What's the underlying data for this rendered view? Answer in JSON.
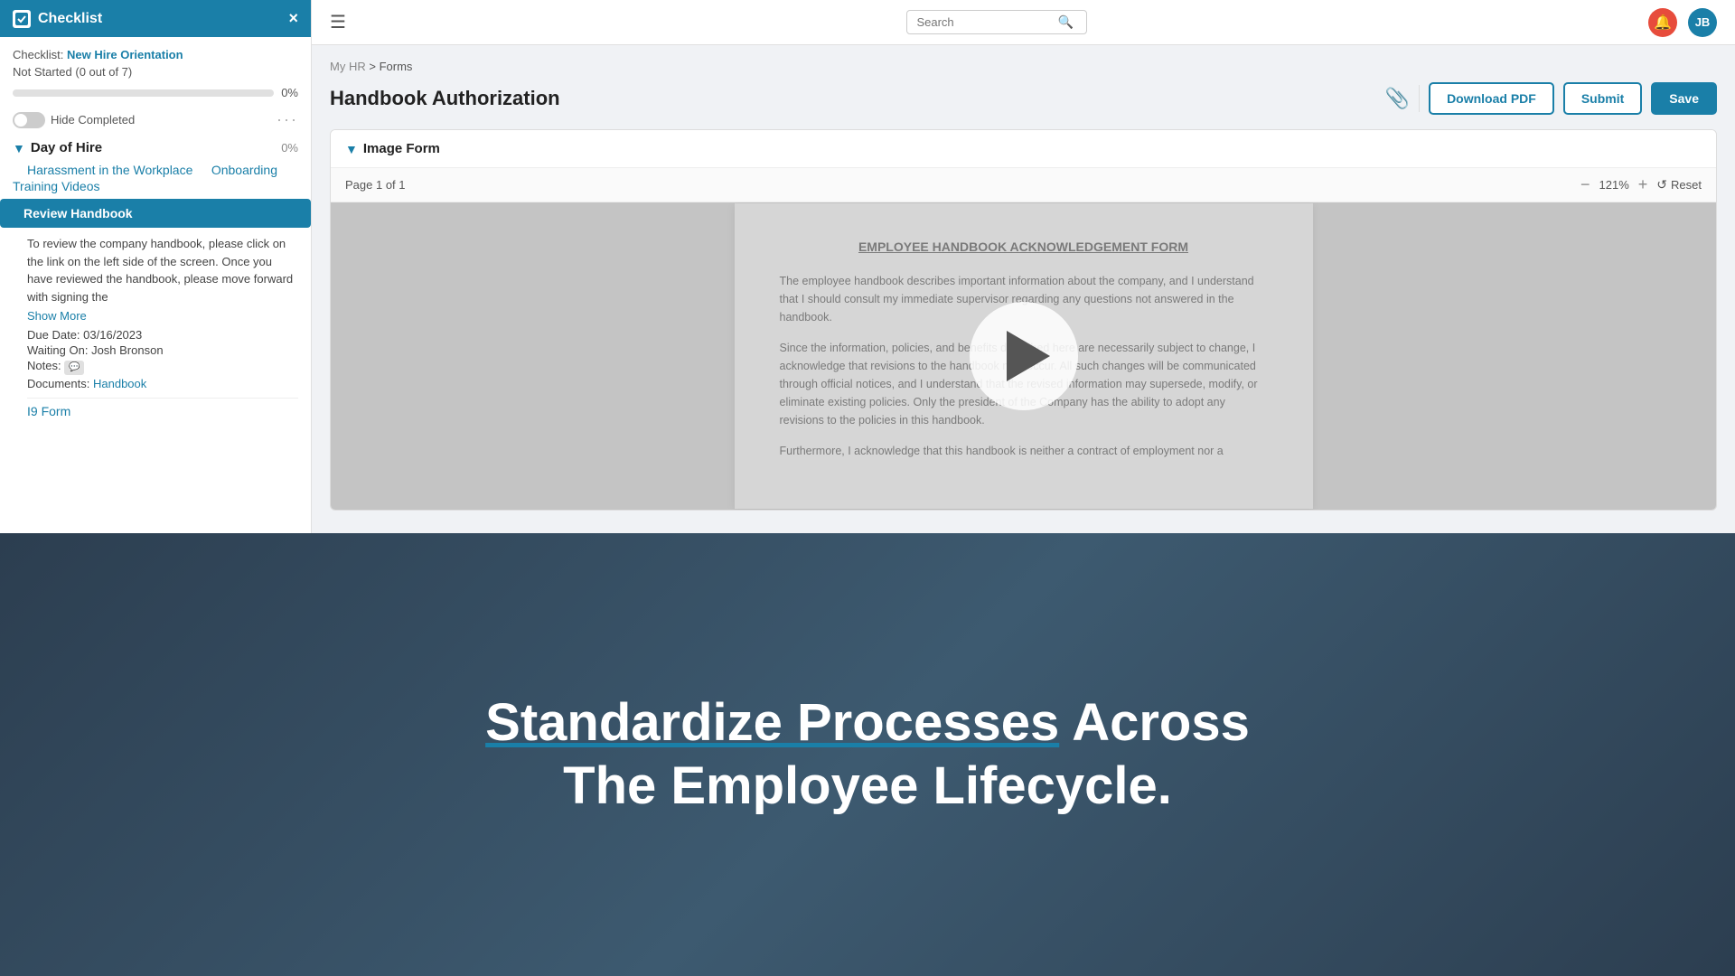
{
  "sidebar": {
    "header": {
      "title": "Checklist",
      "close_icon": "×"
    },
    "checklist_meta": "Checklist:",
    "checklist_name": "New Hire Orientation",
    "status": "Not Started (0 out of 7)",
    "progress_percent": 0,
    "progress_label": "0%",
    "hide_completed_label": "Hide Completed",
    "dots": "···",
    "section": {
      "title": "Day of Hire",
      "percent": "0%"
    },
    "items": [
      {
        "label": "Harassment in the Workplace",
        "type": "link"
      },
      {
        "label": "Onboarding Training Videos",
        "type": "link"
      },
      {
        "label": "Review Handbook",
        "type": "active"
      }
    ],
    "task": {
      "description": "To review the company handbook, please click on the link on the left side of the screen. Once you have reviewed the handbook, please move forward with signing the",
      "show_more": "Show More",
      "due_date_label": "Due Date:",
      "due_date": "03/16/2023",
      "waiting_on_label": "Waiting On:",
      "waiting_on": "Josh Bronson",
      "notes_label": "Notes:",
      "documents_label": "Documents:",
      "document_link": "Handbook"
    },
    "next_item": "I9 Form"
  },
  "topbar": {
    "search_placeholder": "Search",
    "notif_label": "🔔",
    "avatar_initials": "JB"
  },
  "breadcrumb": {
    "parent": "My HR",
    "separator": ">",
    "current": "Forms"
  },
  "page": {
    "title": "Handbook Authorization",
    "attach_icon": "📎",
    "download_label": "Download PDF",
    "submit_label": "Submit",
    "save_label": "Save"
  },
  "form_card": {
    "label": "Image Form",
    "page_info": "Page 1 of 1",
    "zoom_level": "121%",
    "reset_label": "Reset"
  },
  "document": {
    "title": "EMPLOYEE HANDBOOK ACKNOWLEDGEMENT FORM",
    "para1": "The employee handbook describes important information about the company, and I understand that I should consult my immediate supervisor regarding any questions not answered in the handbook.",
    "para2": "Since the information, policies, and benefits described here are necessarily subject to change, I acknowledge that revisions to the handbook may occur. All such changes will be communicated through official notices, and I understand that the revised information may supersede, modify, or eliminate existing policies. Only the president of the Company has the ability to adopt any revisions to the policies in this handbook.",
    "para3": "Furthermore, I acknowledge that this handbook is neither a contract of employment nor a"
  },
  "promo": {
    "line1_normal": "",
    "line1_highlight": "Standardize Processes",
    "line1_suffix": " Across",
    "line2": "The Employee Lifecycle."
  }
}
